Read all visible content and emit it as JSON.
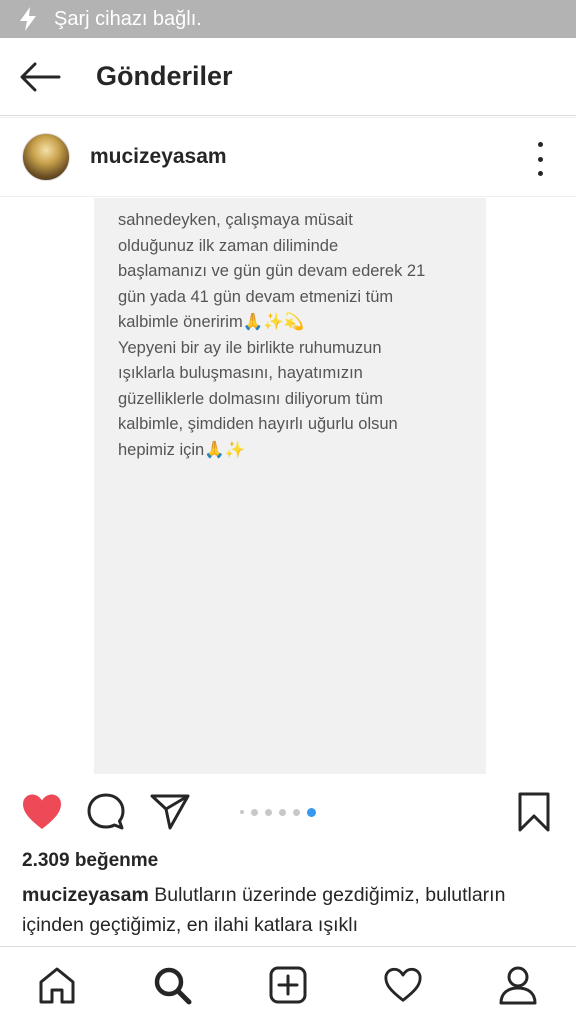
{
  "status_bar": {
    "text": "Şarj cihazı bağlı.",
    "icon": "charging-bolt-icon"
  },
  "header": {
    "title": "Gönderiler",
    "back_icon": "arrow-left-icon"
  },
  "post": {
    "username": "mucizeyasam",
    "media_text": "sahnedeyken, çalışmaya müsait\nolduğunuz ilk zaman diliminde\nbaşlamanızı ve gün gün devam ederek 21\ngün yada 41 gün devam etmenizi tüm\nkalbimle öneririm🙏✨💫\nYepyeni bir ay ile birlikte ruhumuzun\nışıklarla buluşmasını, hayatımızın\ngüzelliklerle dolmasını diliyorum tüm\nkalbimle, şimdiden hayırlı uğurlu olsun\nhepimiz için🙏✨",
    "likes": "2.309 beğenme",
    "caption_user": "mucizeyasam",
    "caption_text": " Bulutların üzerinde gezdiğimiz, bulutların içinden geçtiğimiz, en ilahi katlara ışıklı",
    "carousel": {
      "total": 6,
      "active_index": 5
    },
    "liked": true
  },
  "colors": {
    "like": "#ed4956",
    "active_dot": "#3897f0",
    "status_bar": "#b3b3b3"
  },
  "nav": [
    "home-icon",
    "search-icon",
    "add-post-icon",
    "activity-heart-icon",
    "profile-icon"
  ]
}
